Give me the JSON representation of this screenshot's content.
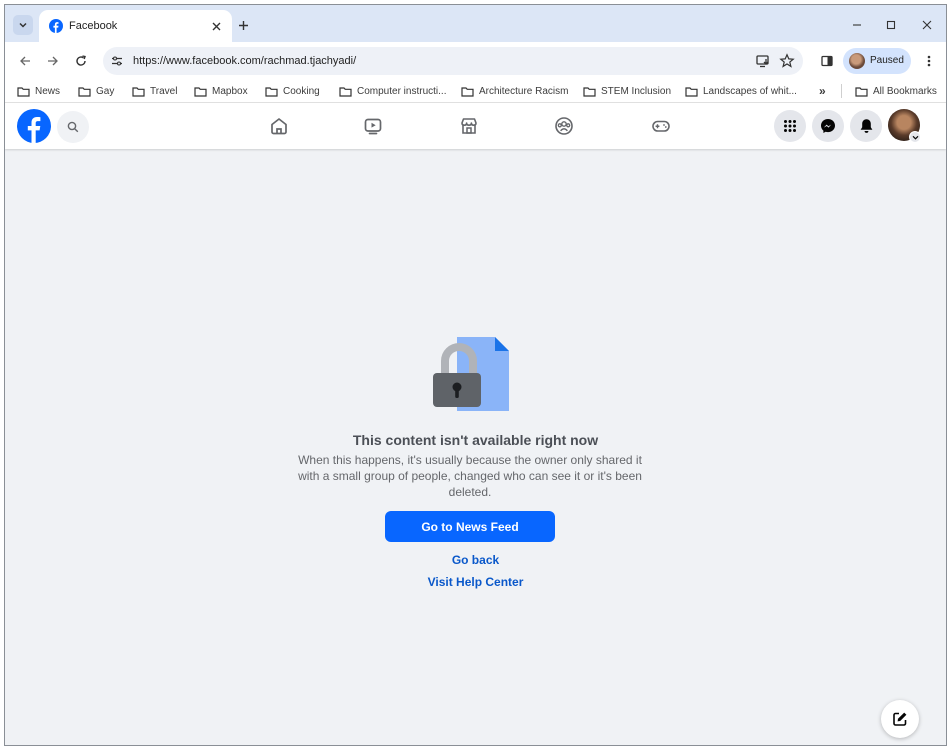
{
  "browser": {
    "tab": {
      "title": "Facebook"
    },
    "url": "https://www.facebook.com/rachmad.tjachyadi/",
    "profile_label": "Paused",
    "bookmarks": [
      {
        "label": "News"
      },
      {
        "label": "Gay"
      },
      {
        "label": "Travel"
      },
      {
        "label": "Mapbox"
      },
      {
        "label": "Cooking"
      },
      {
        "label": "Computer instructi..."
      },
      {
        "label": "Architecture Racism"
      },
      {
        "label": "STEM Inclusion"
      },
      {
        "label": "Landscapes of whit..."
      }
    ],
    "bookmarks_overflow": "»",
    "all_bookmarks": "All Bookmarks"
  },
  "page": {
    "title": "This content isn't available right now",
    "body": "When this happens, it's usually because the owner only shared it with a small group of people, changed who can see it or it's been deleted.",
    "primary_button": "Go to News Feed",
    "go_back": "Go back",
    "help_center": "Visit Help Center"
  },
  "colors": {
    "facebook_blue": "#0866ff",
    "link_blue": "#0a58ca",
    "page_background": "#f0f2f5"
  },
  "icons": {
    "header_nav": [
      "home-icon",
      "watch-icon",
      "marketplace-icon",
      "groups-icon",
      "gaming-icon"
    ],
    "header_right": [
      "menu-grid-icon",
      "messenger-icon",
      "notifications-bell-icon",
      "account-avatar"
    ]
  }
}
